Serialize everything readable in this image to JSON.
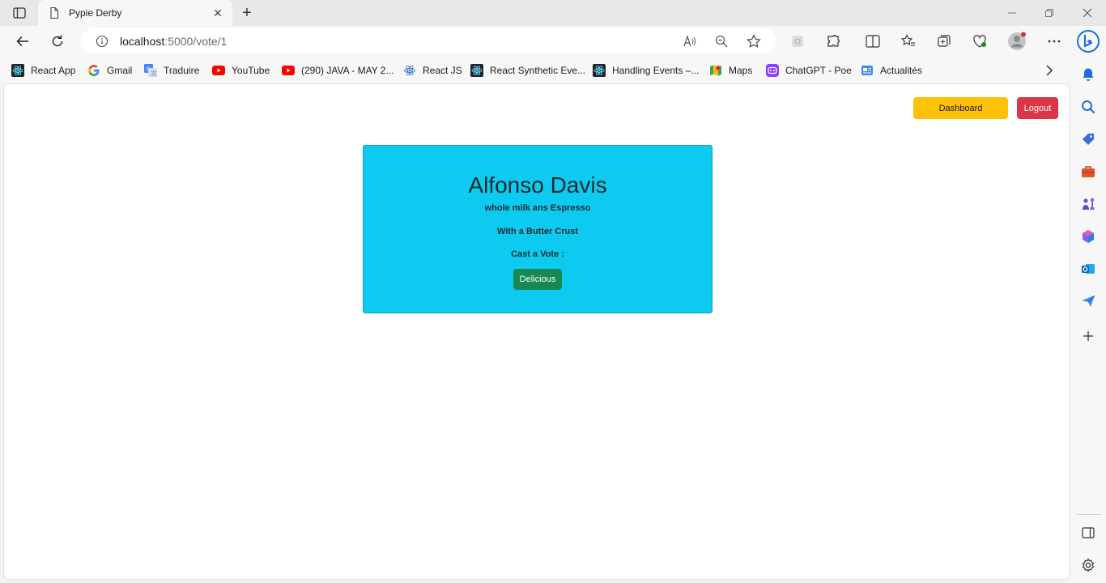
{
  "browser": {
    "tab": {
      "title": "Pypie Derby"
    },
    "address": {
      "host": "localhost",
      "path": ":5000/vote/1"
    },
    "favorites": [
      {
        "label": "React App",
        "icon": "react-icon"
      },
      {
        "label": "Gmail",
        "icon": "google-icon"
      },
      {
        "label": "Traduire",
        "icon": "translate-icon"
      },
      {
        "label": "YouTube",
        "icon": "youtube-icon"
      },
      {
        "label": "(290) JAVA - MAY 2...",
        "icon": "youtube-icon"
      },
      {
        "label": "React JS",
        "icon": "react-icon"
      },
      {
        "label": "React Synthetic Eve...",
        "icon": "react-icon"
      },
      {
        "label": "Handling Events –...",
        "icon": "react-icon"
      },
      {
        "label": "Maps",
        "icon": "maps-icon"
      },
      {
        "label": "ChatGPT - Poe",
        "icon": "poe-icon"
      },
      {
        "label": "Actualités",
        "icon": "news-icon"
      }
    ]
  },
  "page": {
    "dashboard_label": "Dashboard",
    "logout_label": "Logout",
    "card": {
      "name": "Alfonso Davis",
      "line1": "whole milk ans Espresso",
      "line2": "With a Butter Crust",
      "line3": "Cast a Vote :",
      "vote_label": "Delicious"
    }
  },
  "colors": {
    "dashboard": "#ffc107",
    "logout": "#dc3545",
    "card": "#0dcaf0",
    "vote": "#198754"
  }
}
